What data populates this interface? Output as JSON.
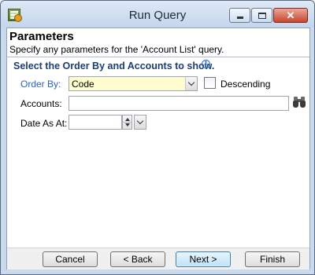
{
  "window": {
    "title": "Run Query",
    "controls": {
      "minimize": "minimize",
      "maximize": "maximize",
      "close": "✕"
    }
  },
  "header": {
    "title": "Parameters",
    "subtitle": "Specify any parameters for the 'Account List' query."
  },
  "section": {
    "title": "Select the Order By and Accounts to show.",
    "info_icon": "i"
  },
  "fields": {
    "order_by": {
      "label": "Order By:",
      "value": "Code"
    },
    "descending": {
      "label": "Descending",
      "checked": false
    },
    "accounts": {
      "label": "Accounts:",
      "value": ""
    },
    "date_as_at": {
      "label": "Date As At:",
      "value": ""
    }
  },
  "footer": {
    "cancel": "Cancel",
    "back": "< Back",
    "next": "Next >",
    "finish": "Finish"
  },
  "colors": {
    "accent_label": "#2863c4",
    "section_title": "#1c3e73",
    "combo_highlight": "#fffdd0"
  }
}
